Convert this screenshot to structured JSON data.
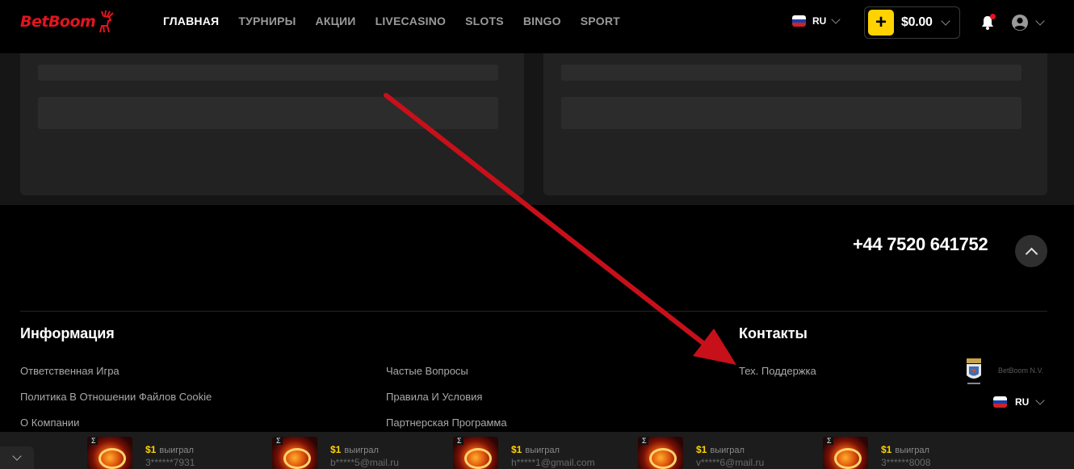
{
  "header": {
    "logo": {
      "brand_red": "Bet",
      "brand_white": "Boom"
    },
    "nav": [
      {
        "label": "ГЛАВНАЯ",
        "active": true
      },
      {
        "label": "ТУРНИРЫ",
        "active": false
      },
      {
        "label": "АКЦИИ",
        "active": false
      },
      {
        "label": "LIVECASINO",
        "active": false
      },
      {
        "label": "SLOTS",
        "active": false
      },
      {
        "label": "BINGO",
        "active": false
      },
      {
        "label": "SPORT",
        "active": false
      }
    ],
    "language": "RU",
    "balance": "$0.00",
    "deposit_icon": "plus-icon",
    "notification_icon": "bell-icon",
    "user_icon": "user-avatar-icon"
  },
  "contact": {
    "phone": "+44 7520 641752"
  },
  "footer": {
    "info_heading": "Информация",
    "contacts_heading": "Контакты",
    "links_col1": [
      "Ответственная Игра",
      "Политика В Отношении Файлов Cookie",
      "О Компании"
    ],
    "links_col2": [
      "Частые Вопросы",
      "Правила И Условия",
      "Партнерская Программа"
    ],
    "support_link": "Тех. Поддержка",
    "company_name": "BetBoom N.V.",
    "language": "RU"
  },
  "ticker": {
    "wins": [
      {
        "amount": "$1",
        "verb": "выиграл",
        "user": "3******7931"
      },
      {
        "amount": "$1",
        "verb": "выиграл",
        "user": "b*****5@mail.ru"
      },
      {
        "amount": "$1",
        "verb": "выиграл",
        "user": "h*****1@gmail.com"
      },
      {
        "amount": "$1",
        "verb": "выиграл",
        "user": "v*****6@mail.ru"
      },
      {
        "amount": "$1",
        "verb": "выиграл",
        "user": "3******8008"
      }
    ]
  },
  "colors": {
    "accent_yellow": "#ffd200",
    "brand_red": "#e3141f",
    "annotation_arrow": "#c8101a"
  }
}
